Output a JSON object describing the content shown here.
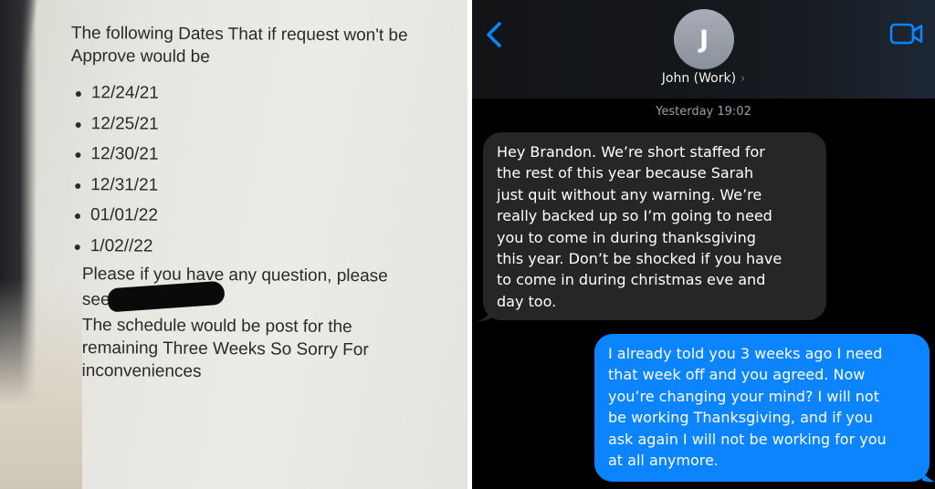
{
  "left_photo": {
    "heading": "The following Dates That if request won't be\nApprove would be",
    "dates": [
      "12/24/21",
      "12/25/21",
      "12/30/21",
      "12/31/21",
      "01/01/22",
      "1/02//22"
    ],
    "question_line1": "Please if you have any question, please",
    "question_line2": "see",
    "schedule_note": "The schedule would be post for the\nremaining Three Weeks So Sorry For\ninconveniences"
  },
  "chat": {
    "contact_initial": "J",
    "contact_name": "John (Work)",
    "contact_chevron": "›",
    "timestamp": "Yesterday 19:02",
    "icons": {
      "back": "chevron-left-icon",
      "video": "video-camera-icon"
    },
    "messages": [
      {
        "direction": "incoming",
        "text": "Hey Brandon. We’re short staffed for\nthe rest of this year because Sarah\njust quit without any warning. We’re\nreally backed up so I’m going to need\nyou to come in during thanksgiving\nthis year. Don’t be shocked if you have\nto come in during christmas eve and\nday too."
      },
      {
        "direction": "outgoing",
        "text": "I already told you 3 weeks ago I need\nthat week off and you agreed. Now\nyou’re changing your mind? I will not\nbe working Thanksgiving, and if you\nask again I will not be working for you\nat all anymore."
      }
    ]
  },
  "colors": {
    "imessage_blue": "#0b84fe",
    "incoming_gray": "#262628",
    "ios_accent": "#0a84ff",
    "paper": "#e9e8e3"
  }
}
